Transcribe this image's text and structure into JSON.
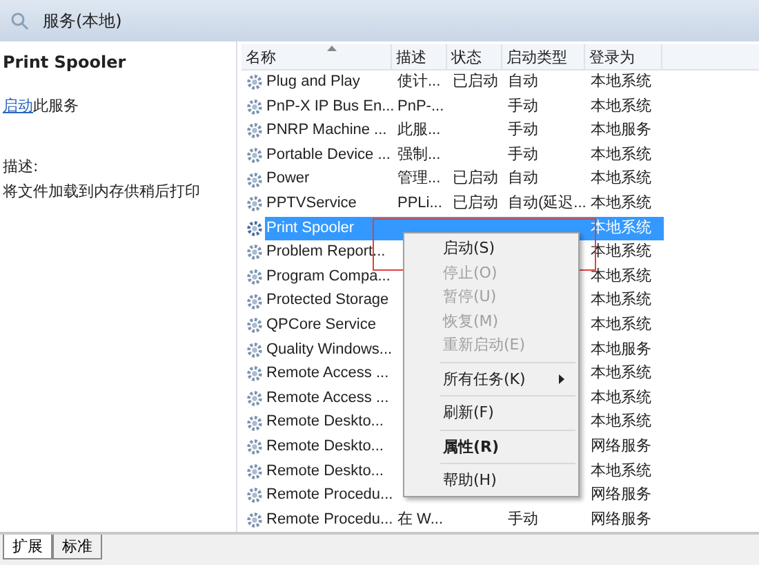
{
  "window": {
    "title": "服务(本地)"
  },
  "detail": {
    "title": "Print Spooler",
    "action_link": "启动",
    "action_rest": "此服务",
    "description_label": "描述:",
    "description": "将文件加载到内存供稍后打印"
  },
  "table": {
    "columns": [
      "名称",
      "描述",
      "状态",
      "启动类型",
      "登录为"
    ],
    "rows": [
      {
        "name": "Plug and Play",
        "description": "使计...",
        "status": "已启动",
        "startup": "自动",
        "logon": "本地系统",
        "selected": false
      },
      {
        "name": "PnP-X IP Bus En...",
        "description": "PnP-...",
        "startup": "手动",
        "logon": "本地系统",
        "selected": false
      },
      {
        "name": "PNRP Machine ...",
        "description": "此服...",
        "startup": "手动",
        "logon": "本地服务",
        "selected": false
      },
      {
        "name": "Portable Device ...",
        "description": "强制...",
        "startup": "手动",
        "logon": "本地系统",
        "selected": false
      },
      {
        "name": "Power",
        "description": "管理...",
        "status": "已启动",
        "startup": "自动",
        "logon": "本地系统",
        "selected": false
      },
      {
        "name": "PPTVService",
        "description": "PPLi...",
        "status": "已启动",
        "startup": "自动(延迟...",
        "logon": "本地系统",
        "selected": false
      },
      {
        "name": "Print Spooler",
        "logon": "本地系统",
        "selected": true
      },
      {
        "name": "Problem Report...",
        "logon": "本地系统",
        "selected": false
      },
      {
        "name": "Program Compa...",
        "logon": "本地系统",
        "selected": false
      },
      {
        "name": "Protected Storage",
        "logon": "本地系统",
        "selected": false
      },
      {
        "name": "QPCore Service",
        "logon": "本地系统",
        "selected": false
      },
      {
        "name": "Quality Windows...",
        "logon": "本地服务",
        "selected": false
      },
      {
        "name": "Remote Access ...",
        "logon": "本地系统",
        "selected": false
      },
      {
        "name": "Remote Access ...",
        "logon": "本地系统",
        "selected": false
      },
      {
        "name": "Remote Deskto...",
        "logon": "本地系统",
        "selected": false
      },
      {
        "name": "Remote Deskto...",
        "logon": "网络服务",
        "selected": false
      },
      {
        "name": "Remote Deskto...",
        "logon": "本地系统",
        "selected": false
      },
      {
        "name": "Remote Procedu...",
        "logon": "网络服务",
        "selected": false
      },
      {
        "name": "Remote Procedu...",
        "description": "在 W...",
        "startup": "手动",
        "logon": "网络服务",
        "selected": false
      }
    ]
  },
  "context_menu": {
    "groups": [
      [
        {
          "label": "启动(S)",
          "disabled": false,
          "bold": false
        },
        {
          "label": "停止(O)",
          "disabled": true,
          "bold": false
        },
        {
          "label": "暂停(U)",
          "disabled": true,
          "bold": false
        },
        {
          "label": "恢复(M)",
          "disabled": true,
          "bold": false
        },
        {
          "label": "重新启动(E)",
          "disabled": true,
          "bold": false
        }
      ],
      [
        {
          "label": "所有任务(K)",
          "disabled": false,
          "bold": false,
          "submenu": true
        }
      ],
      [
        {
          "label": "刷新(F)",
          "disabled": false,
          "bold": false
        }
      ],
      [
        {
          "label": "属性(R)",
          "disabled": false,
          "bold": true
        }
      ],
      [
        {
          "label": "帮助(H)",
          "disabled": false,
          "bold": false
        }
      ]
    ]
  },
  "tabs": [
    {
      "label": "扩展",
      "selected": true
    },
    {
      "label": "标准",
      "selected": false
    }
  ]
}
